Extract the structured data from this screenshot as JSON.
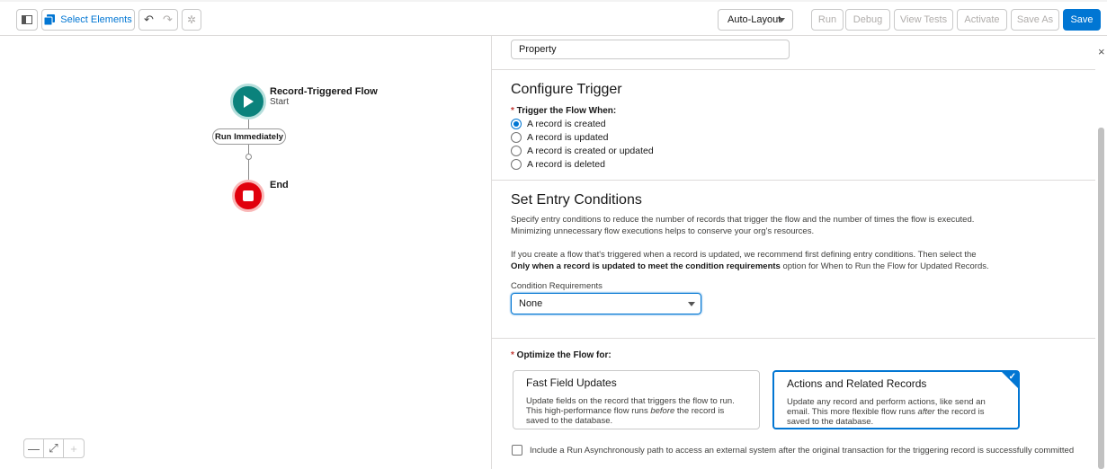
{
  "toolbar": {
    "select_elements_label": "Select Elements",
    "layout_mode": "Auto-Layout",
    "run_label": "Run",
    "debug_label": "Debug",
    "view_tests_label": "View Tests",
    "activate_label": "Activate",
    "save_as_label": "Save As",
    "save_label": "Save"
  },
  "canvas": {
    "start_title": "Record-Triggered Flow",
    "start_sub": "Start",
    "path_label": "Run Immediately",
    "end_label": "End",
    "zoom_out": "—",
    "zoom_fit": "⤢",
    "zoom_in": "+"
  },
  "panel": {
    "object_value": "Property",
    "close_icon": "×",
    "configure": {
      "heading": "Configure Trigger",
      "label": "Trigger the Flow When:",
      "options": [
        {
          "label": "A record is created",
          "checked": true
        },
        {
          "label": "A record is updated",
          "checked": false
        },
        {
          "label": "A record is created or updated",
          "checked": false
        },
        {
          "label": "A record is deleted",
          "checked": false
        }
      ]
    },
    "entry": {
      "heading": "Set Entry Conditions",
      "p1": "Specify entry conditions to reduce the number of records that trigger the flow and the number of times the flow is executed.",
      "p2": "Minimizing unnecessary flow executions helps to conserve your org's resources.",
      "p3": "If you create a flow that's triggered when a record is updated, we recommend first defining entry conditions. Then select the",
      "p4_bold": "Only when a record is updated to meet the condition requirements",
      "p4_rest": " option for When to Run the Flow for Updated Records.",
      "condition_label": "Condition Requirements",
      "condition_value": "None"
    },
    "optimize": {
      "label": "Optimize the Flow for:",
      "fast": {
        "title": "Fast Field Updates",
        "desc1": "Update fields on the record that triggers the flow to run.",
        "desc2a": "This high-performance flow runs ",
        "desc2_em": "before",
        "desc2b": " the record is",
        "desc3": "saved to the database."
      },
      "actions": {
        "title": "Actions and Related Records",
        "desc1": "Update any record and perform actions, like send an",
        "desc2a": "email. This more flexible flow runs ",
        "desc2_em": "after",
        "desc2b": " the record is",
        "desc3": "saved to the database."
      },
      "async_label": "Include a Run Asynchronously path to access an external system after the original transaction for the triggering record is successfully committed"
    }
  },
  "colors": {
    "brand": "#0176d3",
    "start": "#0b827c",
    "end": "#e1000c"
  }
}
